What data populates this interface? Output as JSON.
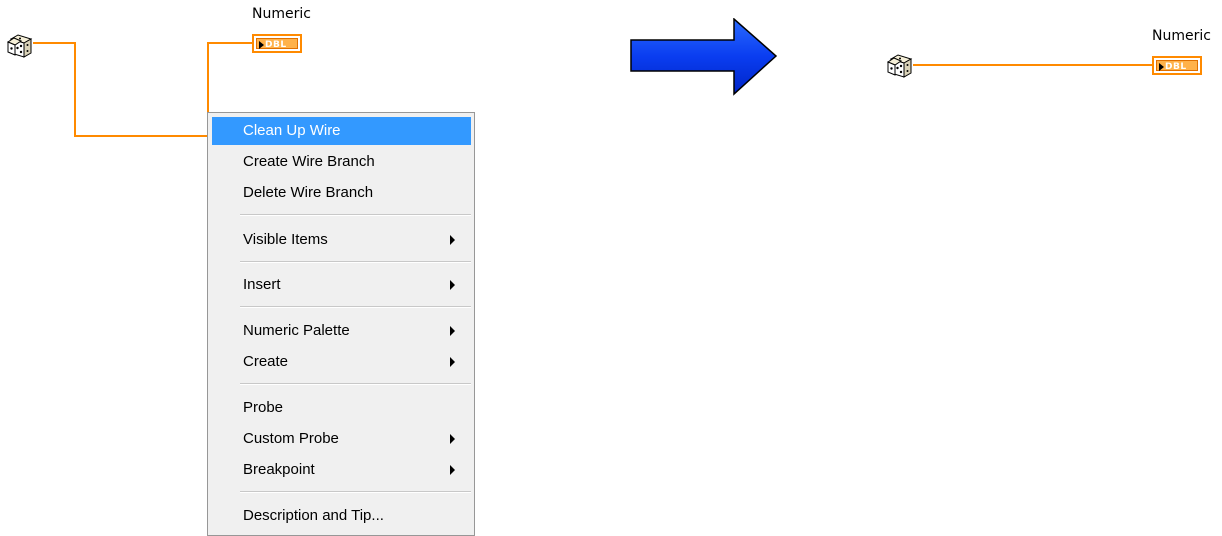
{
  "before": {
    "terminal_label": "Numeric",
    "terminal_type": "DBL"
  },
  "after": {
    "terminal_label": "Numeric",
    "terminal_type": "DBL"
  },
  "context_menu": {
    "items": [
      {
        "label": "Clean Up Wire",
        "selected": true,
        "submenu": false
      },
      {
        "label": "Create Wire Branch",
        "submenu": false
      },
      {
        "label": "Delete Wire Branch",
        "submenu": false
      },
      {
        "label": "Visible Items",
        "submenu": true
      },
      {
        "label": "Insert",
        "submenu": true
      },
      {
        "label": "Numeric Palette",
        "submenu": true
      },
      {
        "label": "Create",
        "submenu": true
      },
      {
        "label": "Probe",
        "submenu": false
      },
      {
        "label": "Custom Probe",
        "submenu": true
      },
      {
        "label": "Breakpoint",
        "submenu": true
      },
      {
        "label": "Description and Tip...",
        "submenu": false
      }
    ]
  },
  "colors": {
    "wire": "#ff8a00",
    "menu_highlight": "#3399ff",
    "arrow": "#0033ff"
  },
  "icons": [
    "dice-icon",
    "submenu-arrow-icon",
    "right-arrow-icon"
  ]
}
